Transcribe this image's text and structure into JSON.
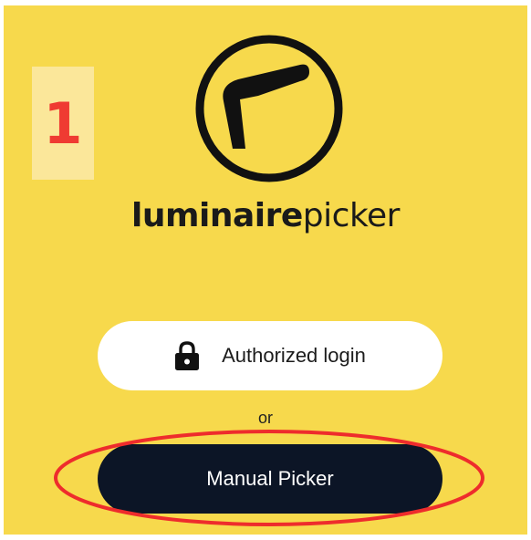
{
  "step_badge": {
    "number": "1",
    "text_color": "#ef3b32",
    "background": "#fbe79a"
  },
  "brand": {
    "name_bold": "luminaire",
    "name_light": "picker",
    "logo_icon": "luminaire-lamp-logo-icon"
  },
  "auth": {
    "login_label": "Authorized login",
    "login_icon": "lock-icon",
    "separator": "or",
    "manual_label": "Manual Picker"
  },
  "annotation": {
    "highlight_color": "#ee2c2c",
    "target": "manual-picker-button"
  },
  "colors": {
    "background": "#f7d94c",
    "primary_button": "#0c1526",
    "secondary_button": "#ffffff"
  }
}
